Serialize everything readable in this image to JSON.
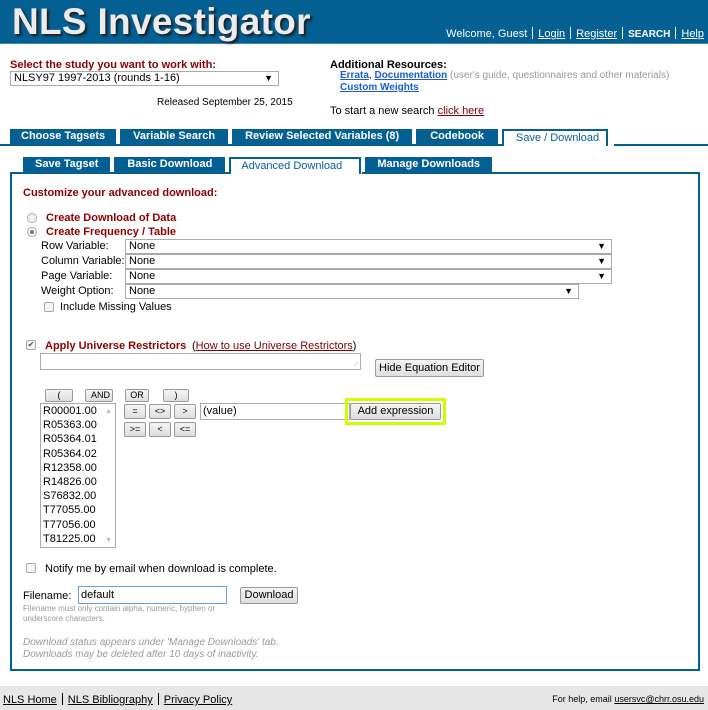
{
  "header": {
    "title": "NLS Investigator",
    "welcome": "Welcome, Guest",
    "nav": {
      "login": "Login",
      "register": "Register",
      "search": "SEARCH",
      "help": "Help"
    }
  },
  "study": {
    "label": "Select the study you want to work with:",
    "selected": "NLSY97 1997-2013 (rounds 1-16)",
    "released": "Released September 25, 2015"
  },
  "resources": {
    "title": "Additional Resources:",
    "errata": "Errata",
    "documentation": "Documentation",
    "documentation_note": "(user's guide, questionnaires and other materials)",
    "custom_weights": "Custom Weights",
    "new_search_text": "To start a new search",
    "new_search_link": "click here"
  },
  "main_tabs": [
    {
      "label": "Choose Tagsets",
      "active": false
    },
    {
      "label": "Variable Search",
      "active": false
    },
    {
      "label": "Review Selected Variables (8)",
      "active": false
    },
    {
      "label": "Codebook",
      "active": false
    },
    {
      "label": "Save / Download",
      "active": true
    }
  ],
  "sub_tabs": [
    {
      "label": "Save Tagset",
      "active": false
    },
    {
      "label": "Basic Download",
      "active": false
    },
    {
      "label": "Advanced Download",
      "active": true
    },
    {
      "label": "Manage Downloads",
      "active": false
    }
  ],
  "panel": {
    "title": "Customize your advanced download:",
    "options": {
      "download_data": {
        "label": "Create Download of Data",
        "checked": false
      },
      "frequency_table": {
        "label": "Create Frequency / Table",
        "checked": true
      }
    },
    "fields": {
      "row": {
        "label": "Row Variable:",
        "value": "None"
      },
      "column": {
        "label": "Column Variable:",
        "value": "None"
      },
      "page": {
        "label": "Page Variable:",
        "value": "None"
      },
      "weight": {
        "label": "Weight Option:",
        "value": "None"
      }
    },
    "include_missing": {
      "label": "Include Missing Values",
      "checked": false
    },
    "universe": {
      "label": "Apply Universe Restrictors",
      "checked": true,
      "help_open": "(",
      "help_link": "How to use Universe Restrictors",
      "help_close": ")",
      "expression": "",
      "hide_editor": "Hide Equation Editor"
    },
    "equation_editor": {
      "paren_open": "(",
      "and": "AND",
      "or": "OR",
      "paren_close": ")",
      "ops": [
        "=",
        "<>",
        ">",
        ">=",
        "<",
        "<="
      ],
      "variables": [
        "R00001.00",
        "R05363.00",
        "R05364.01",
        "R05364.02",
        "R12358.00",
        "R14826.00",
        "S76832.00",
        "T77055.00",
        "T77056.00",
        "T81225.00"
      ],
      "value_input": "(value)",
      "add_expression": "Add expression"
    },
    "notify": {
      "label": "Notify me by email when download is complete.",
      "checked": false
    },
    "filename": {
      "label": "Filename:",
      "value": "default",
      "hint": "Filename must only contain alpha, numeric, hyphen or underscore characters.",
      "download_button": "Download"
    },
    "status_note_1": "Download status appears under 'Manage Downloads' tab.",
    "status_note_2": "Downloads may be deleted after 10 days of inactivity."
  },
  "footer": {
    "links": [
      "NLS Home",
      "NLS Bibliography",
      "Privacy Policy"
    ],
    "help_text": "For help, email",
    "help_email": "usersvc@chrr.osu.edu"
  },
  "colors": {
    "brand_blue": "#045f93",
    "label_red": "#8b0000",
    "link_blue": "#1a5bd6",
    "highlight": "#ccff00"
  }
}
